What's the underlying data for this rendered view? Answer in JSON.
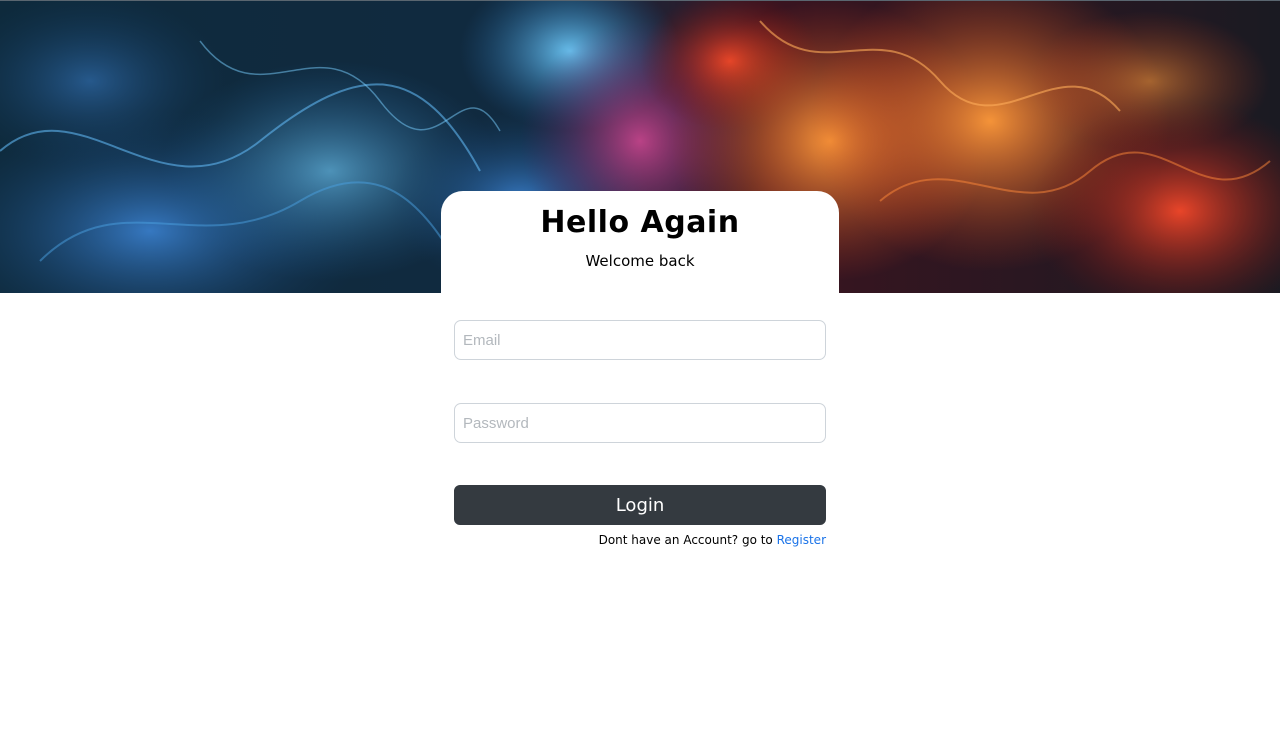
{
  "login": {
    "title": "Hello Again",
    "subtitle": "Welcome back",
    "email_placeholder": "Email",
    "email_value": "",
    "password_placeholder": "Password",
    "password_value": "",
    "login_label": "Login",
    "register_prompt": "Dont have an Account? go to ",
    "register_link_label": "Register"
  },
  "colors": {
    "button_bg": "#343a40",
    "link": "#1a73e8",
    "hero_blue": "#3fa0e6",
    "hero_orange": "#f07a2a"
  }
}
